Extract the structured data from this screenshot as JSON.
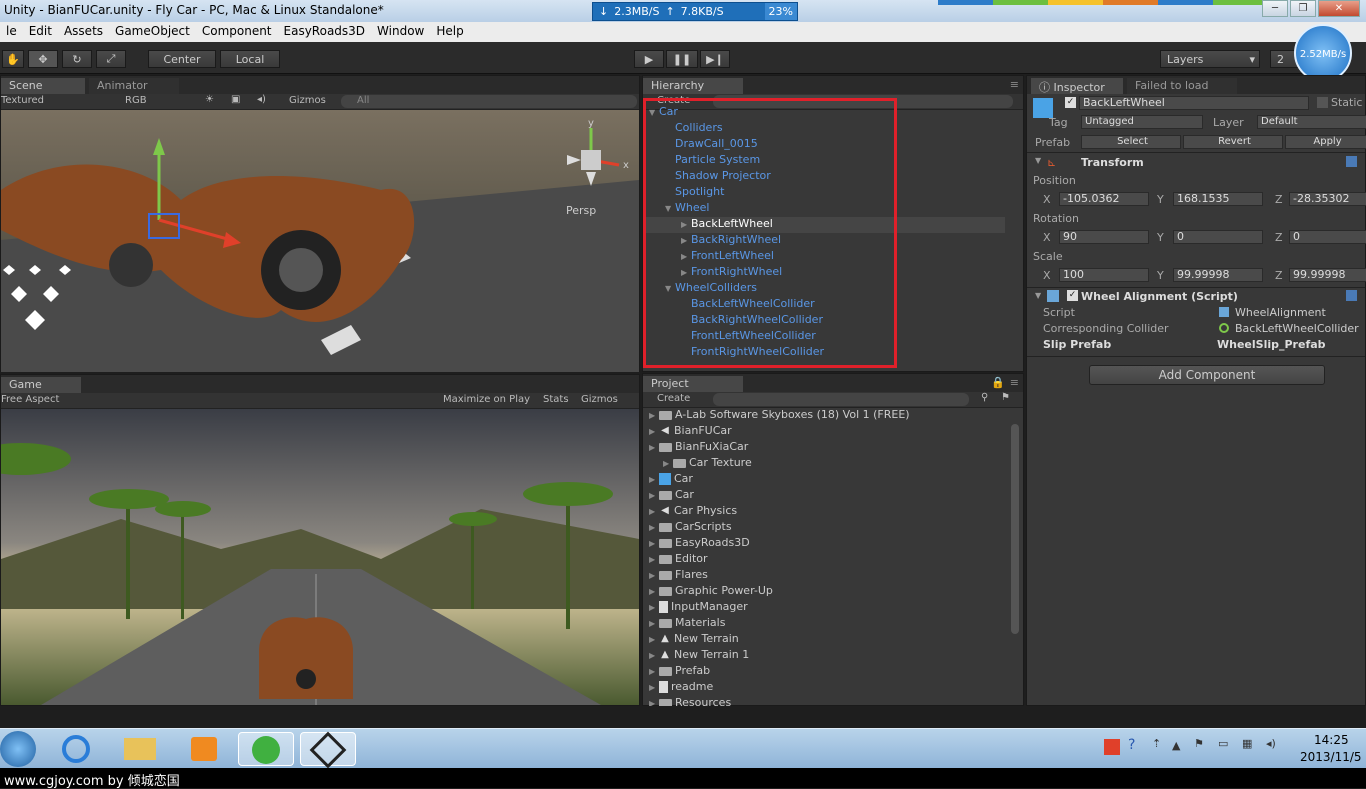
{
  "window": {
    "title": "Unity - BianFUCar.unity - Fly Car - PC, Mac & Linux Standalone*",
    "net_down": "2.3MB/S",
    "net_up": "7.8KB/S",
    "net_pct": "23%",
    "speed_badge": "2.52MB/s"
  },
  "menu": [
    "le",
    "Edit",
    "Assets",
    "GameObject",
    "Component",
    "EasyRoads3D",
    "Window",
    "Help"
  ],
  "toolbar": {
    "center_label": "Center",
    "local_label": "Local",
    "layers_label": "Layers",
    "layout_label": "2"
  },
  "scene": {
    "tab_scene": "Scene",
    "tab_animator": "Animator",
    "shading": "Textured",
    "render": "RGB",
    "gizmos": "Gizmos",
    "search_placeholder": "All",
    "persp": "Persp",
    "axis_y": "y",
    "axis_x": "x"
  },
  "game": {
    "tab": "Game",
    "aspect": "Free Aspect",
    "maximize": "Maximize on Play",
    "stats": "Stats",
    "gizmos": "Gizmos"
  },
  "hierarchy": {
    "tab": "Hierarchy",
    "create": "Create",
    "items": [
      {
        "label": "Car",
        "indent": 0,
        "arrow": "open"
      },
      {
        "label": "Colliders",
        "indent": 1,
        "arrow": ""
      },
      {
        "label": "DrawCall_0015",
        "indent": 1,
        "arrow": ""
      },
      {
        "label": "Particle System",
        "indent": 1,
        "arrow": ""
      },
      {
        "label": "Shadow Projector",
        "indent": 1,
        "arrow": ""
      },
      {
        "label": "Spotlight",
        "indent": 1,
        "arrow": ""
      },
      {
        "label": "Wheel",
        "indent": 1,
        "arrow": "open"
      },
      {
        "label": "BackLeftWheel",
        "indent": 2,
        "arrow": "closed",
        "selected": true
      },
      {
        "label": "BackRightWheel",
        "indent": 2,
        "arrow": "closed"
      },
      {
        "label": "FrontLeftWheel",
        "indent": 2,
        "arrow": "closed"
      },
      {
        "label": "FrontRightWheel",
        "indent": 2,
        "arrow": "closed"
      },
      {
        "label": "WheelColliders",
        "indent": 1,
        "arrow": "open"
      },
      {
        "label": "BackLeftWheelCollider",
        "indent": 2,
        "arrow": ""
      },
      {
        "label": "BackRightWheelCollider",
        "indent": 2,
        "arrow": ""
      },
      {
        "label": "FrontLeftWheelCollider",
        "indent": 2,
        "arrow": ""
      },
      {
        "label": "FrontRightWheelCollider",
        "indent": 2,
        "arrow": ""
      }
    ],
    "highlight_color": "#e0202a"
  },
  "project": {
    "tab": "Project",
    "create": "Create",
    "items": [
      {
        "label": "A-Lab Software Skyboxes (18) Vol 1 (FREE)",
        "icon": "folder",
        "indent": 0
      },
      {
        "label": "BianFUCar",
        "icon": "unity",
        "indent": 0
      },
      {
        "label": "BianFuXiaCar",
        "icon": "folder",
        "indent": 0
      },
      {
        "label": "Car Texture",
        "icon": "folder",
        "indent": 1
      },
      {
        "label": "Car",
        "icon": "prefab",
        "indent": 0
      },
      {
        "label": "Car",
        "icon": "folder",
        "indent": 0
      },
      {
        "label": "Car Physics",
        "icon": "unity",
        "indent": 0
      },
      {
        "label": "CarScripts",
        "icon": "folder",
        "indent": 0
      },
      {
        "label": "EasyRoads3D",
        "icon": "folder",
        "indent": 0
      },
      {
        "label": "Editor",
        "icon": "folder",
        "indent": 0
      },
      {
        "label": "Flares",
        "icon": "folder",
        "indent": 0
      },
      {
        "label": "Graphic Power-Up",
        "icon": "folder",
        "indent": 0
      },
      {
        "label": "InputManager",
        "icon": "file",
        "indent": 0
      },
      {
        "label": "Materials",
        "icon": "folder",
        "indent": 0
      },
      {
        "label": "New Terrain",
        "icon": "terrain",
        "indent": 0
      },
      {
        "label": "New Terrain 1",
        "icon": "terrain",
        "indent": 0
      },
      {
        "label": "Prefab",
        "icon": "folder",
        "indent": 0
      },
      {
        "label": "readme",
        "icon": "file",
        "indent": 0
      },
      {
        "label": "Resources",
        "icon": "folder",
        "indent": 0
      }
    ]
  },
  "inspector": {
    "tab": "Inspector",
    "tab2": "Failed to load",
    "object_name": "BackLeftWheel",
    "static": "Static",
    "tag_label": "Tag",
    "tag_value": "Untagged",
    "layer_label": "Layer",
    "layer_value": "Default",
    "prefab_label": "Prefab",
    "select": "Select",
    "revert": "Revert",
    "apply": "Apply",
    "transform": "Transform",
    "position": "Position",
    "rotation": "Rotation",
    "scale": "Scale",
    "pos": {
      "x": "-105.0362",
      "y": "168.1535",
      "z": "-28.35302"
    },
    "rot": {
      "x": "90",
      "y": "0",
      "z": "0"
    },
    "scl": {
      "x": "100",
      "y": "99.99998",
      "z": "99.99998"
    },
    "script_component": "Wheel Alignment (Script)",
    "script_label": "Script",
    "script_value": "WheelAlignment",
    "collider_label": "Corresponding Collider",
    "collider_value": "BackLeftWheelCollider",
    "slip_label": "Slip Prefab",
    "slip_value": "WheelSlip_Prefab",
    "add_component": "Add Component"
  },
  "taskbar": {
    "time": "14:25",
    "date": "2013/11/5"
  },
  "watermark": "www.cgjoy.com by 倾城恋国"
}
